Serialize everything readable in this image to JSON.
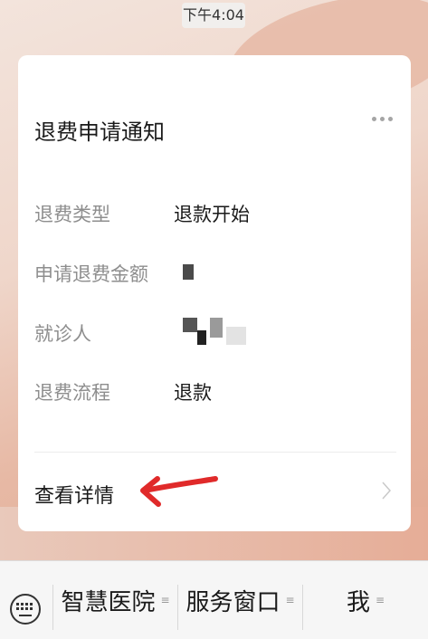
{
  "status": {
    "time": "下午4:04"
  },
  "card": {
    "title": "退费申请通知",
    "fields": [
      {
        "label": "退费类型",
        "value": "退款开始"
      },
      {
        "label": "申请退费金额",
        "value": ""
      },
      {
        "label": "就诊人",
        "value": ""
      },
      {
        "label": "退费流程",
        "value": "退款"
      }
    ],
    "detail_label": "查看详情"
  },
  "annotation": {
    "color": "#e02a2a"
  },
  "bottom_menu": {
    "items": [
      "智慧医院",
      "服务窗口",
      "我"
    ],
    "menu_indicator": "≡"
  }
}
